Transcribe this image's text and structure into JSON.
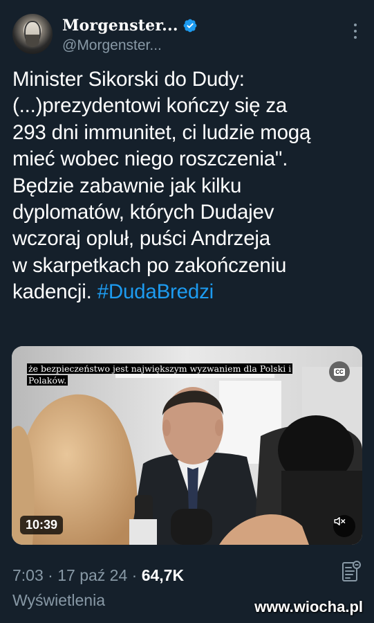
{
  "author": {
    "display_name": "Morgenster...",
    "handle": "@Morgenster..."
  },
  "tweet": {
    "text": "Minister Sikorski do Dudy:\n(...)prezydentowi kończy się za\n293 dni immunitet, ci ludzie mogą\nmieć wobec niego roszczenia\".\nBędzie zabawnie jak kilku\ndyplomatów, których Dudajev\nwczoraj opluł, puści Andrzeja\nw skarpetkach po zakończeniu\nkadencji. ",
    "hashtag": "#DudaBredzi"
  },
  "video": {
    "caption": "że bezpieczeństwo jest największym wyzwaniem dla Polski i Polaków.",
    "duration": "10:39",
    "cc_label": "CC"
  },
  "meta": {
    "time": "7:03",
    "separator": " · ",
    "date": "17 paź 24",
    "views": "64,7K",
    "views_label": "Wyświetlenia"
  },
  "watermark": "www.wiocha.pl",
  "icons": {
    "verified": "verified-badge-icon",
    "more": "more-vertical-icon",
    "mute": "volume-muted-icon",
    "analytics": "analytics-icon"
  },
  "colors": {
    "background": "#15202b",
    "accent": "#1d9bf0",
    "secondary_text": "#8899a6"
  }
}
